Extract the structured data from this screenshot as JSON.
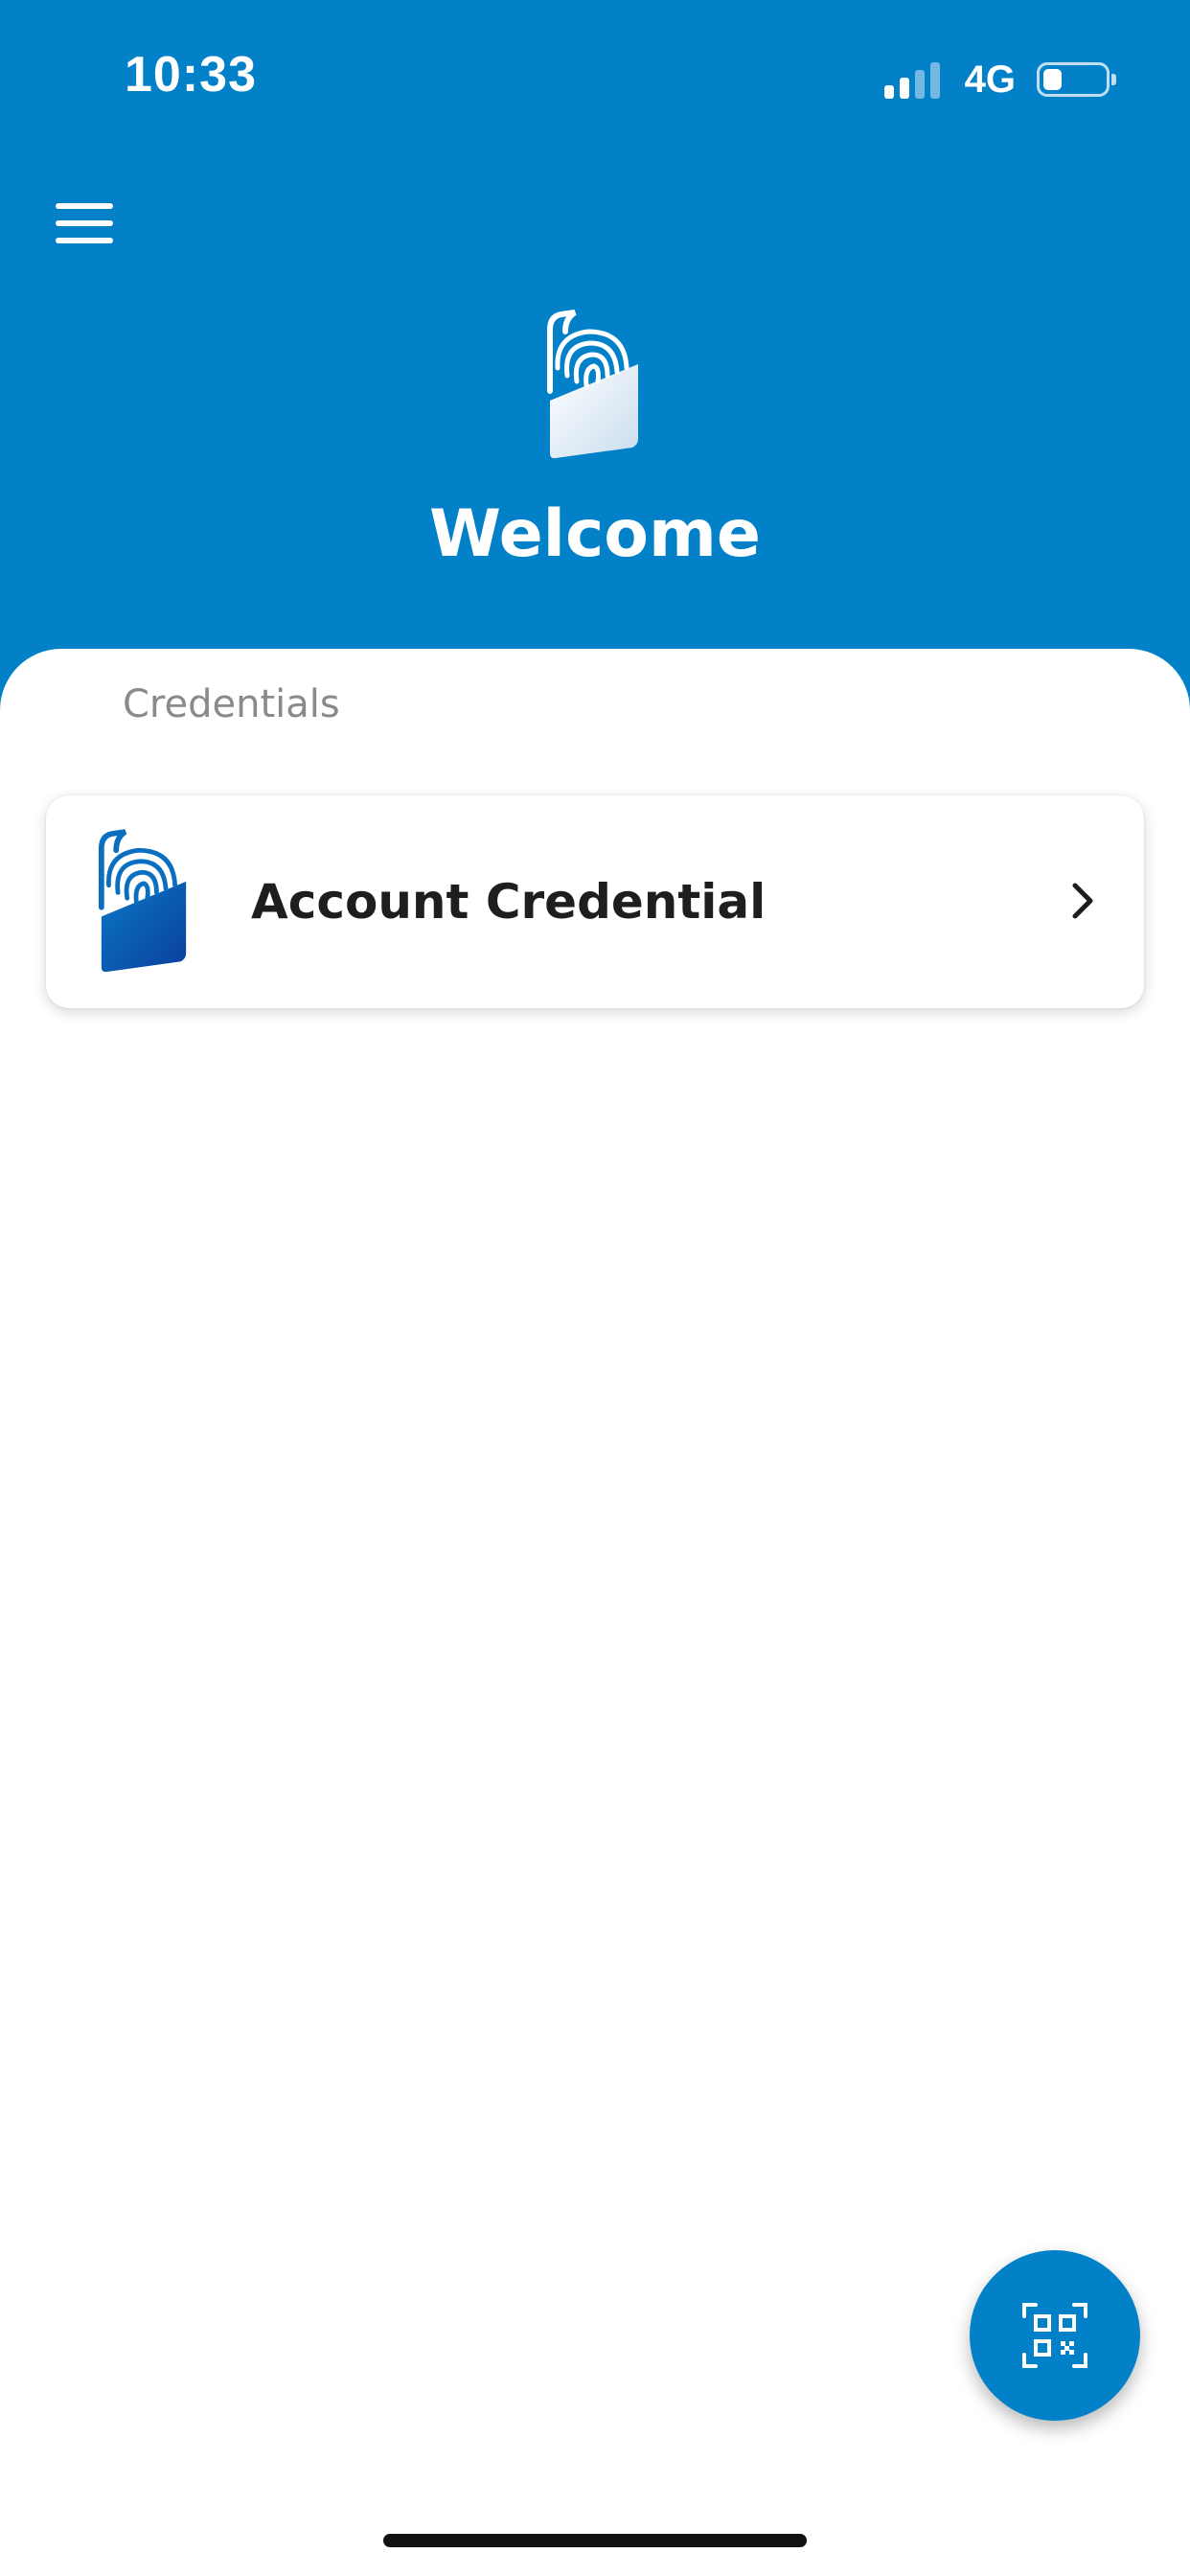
{
  "status_bar": {
    "time": "10:33",
    "network": "4G",
    "signal_bars_active": 2,
    "signal_bars_total": 4,
    "battery_level": 0.3
  },
  "header": {
    "title": "Welcome",
    "background_color": "#0280C8",
    "menu_icon": "hamburger-menu-icon",
    "logo_icon": "fingerprint-wallet-icon"
  },
  "credentials": {
    "section_label": "Credentials",
    "items": [
      {
        "title": "Account Credential",
        "icon": "fingerprint-wallet-icon",
        "chevron_icon": "chevron-right-icon"
      }
    ]
  },
  "fab": {
    "icon": "qr-scan-icon",
    "color": "#0280C8"
  }
}
